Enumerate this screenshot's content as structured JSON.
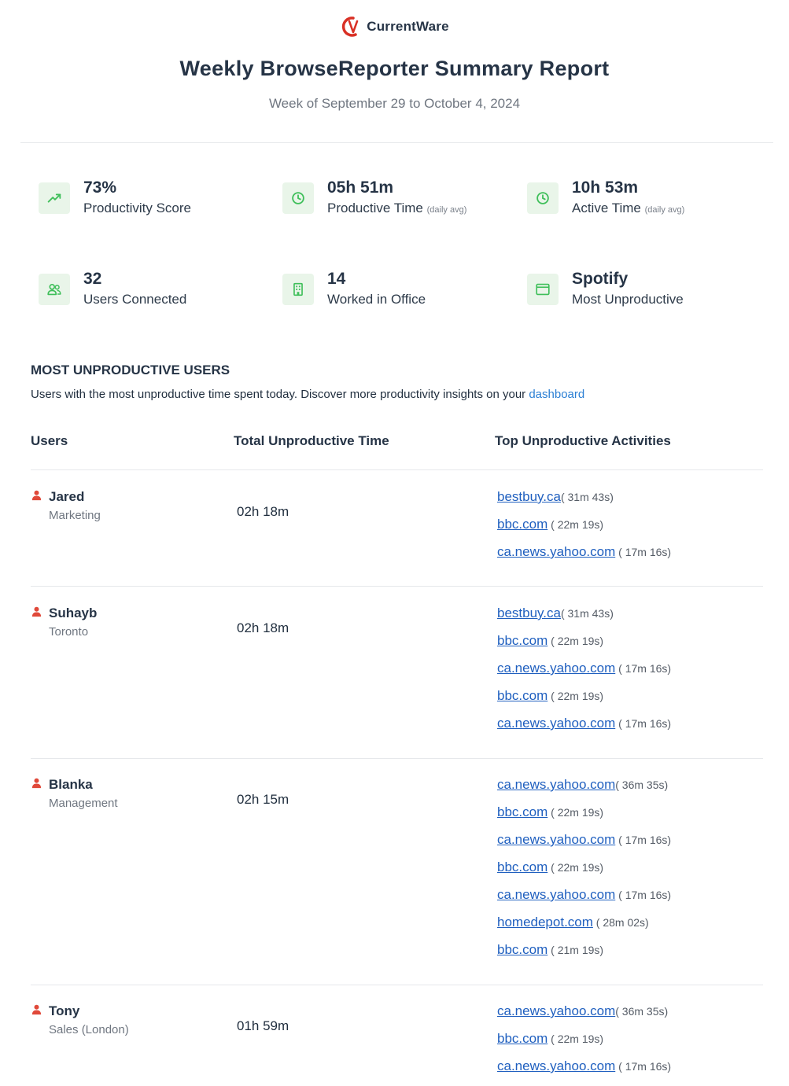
{
  "brand": {
    "name": "CurrentWare",
    "color": "#d93025"
  },
  "report": {
    "title": "Weekly BrowseReporter Summary Report",
    "subtitle": "Week of September 29 to October 4, 2024"
  },
  "stats": [
    {
      "value": "73%",
      "label": "Productivity Score",
      "note": "",
      "icon": "trend-up-icon"
    },
    {
      "value": "05h 51m",
      "label": "Productive Time",
      "note": "(daily avg)",
      "icon": "clock-icon"
    },
    {
      "value": "10h 53m",
      "label": "Active Time",
      "note": "(daily avg)",
      "icon": "clock-icon"
    },
    {
      "value": "32",
      "label": "Users Connected",
      "note": "",
      "icon": "users-icon"
    },
    {
      "value": "14",
      "label": "Worked in Office",
      "note": "",
      "icon": "building-icon"
    },
    {
      "value": "Spotify",
      "label": "Most Unproductive",
      "note": "",
      "icon": "window-icon"
    }
  ],
  "section": {
    "title": "MOST UNPRODUCTIVE USERS",
    "desc": "Users with the most unproductive time spent today. Discover more productivity insights on your",
    "link": "dashboard"
  },
  "table": {
    "headers": [
      "Users",
      "Total Unproductive Time",
      "Top Unproductive Activities"
    ],
    "rows": [
      {
        "name": "Jared",
        "dept": "Marketing",
        "total": "02h 18m",
        "activities": [
          {
            "site": "bestbuy.ca",
            "dur": "( 31m 43s)"
          },
          {
            "site": "bbc.com",
            "dur": " ( 22m 19s)"
          },
          {
            "site": "ca.news.yahoo.com",
            "dur": " ( 17m 16s)"
          }
        ]
      },
      {
        "name": "Suhayb",
        "dept": "Toronto",
        "total": "02h 18m",
        "activities": [
          {
            "site": "bestbuy.ca",
            "dur": "( 31m 43s)"
          },
          {
            "site": "bbc.com",
            "dur": " ( 22m 19s)"
          },
          {
            "site": "ca.news.yahoo.com",
            "dur": " ( 17m 16s)"
          },
          {
            "site": "bbc.com",
            "dur": " ( 22m 19s)"
          },
          {
            "site": "ca.news.yahoo.com",
            "dur": " ( 17m 16s)"
          }
        ]
      },
      {
        "name": "Blanka",
        "dept": "Management",
        "total": "02h 15m",
        "activities": [
          {
            "site": "ca.news.yahoo.com",
            "dur": "( 36m 35s)"
          },
          {
            "site": "bbc.com",
            "dur": " ( 22m 19s)"
          },
          {
            "site": "ca.news.yahoo.com",
            "dur": " ( 17m 16s)"
          },
          {
            "site": "bbc.com",
            "dur": " ( 22m 19s)"
          },
          {
            "site": "ca.news.yahoo.com",
            "dur": " ( 17m 16s)"
          },
          {
            "site": "homedepot.com",
            "dur": " ( 28m 02s)"
          },
          {
            "site": "bbc.com",
            "dur": " ( 21m 19s)"
          }
        ]
      },
      {
        "name": "Tony",
        "dept": "Sales (London)",
        "total": "01h 59m",
        "activities": [
          {
            "site": "ca.news.yahoo.com",
            "dur": "( 36m 35s)"
          },
          {
            "site": "bbc.com",
            "dur": " ( 22m 19s)"
          },
          {
            "site": "ca.news.yahoo.com",
            "dur": " ( 17m 16s)"
          }
        ]
      }
    ]
  }
}
